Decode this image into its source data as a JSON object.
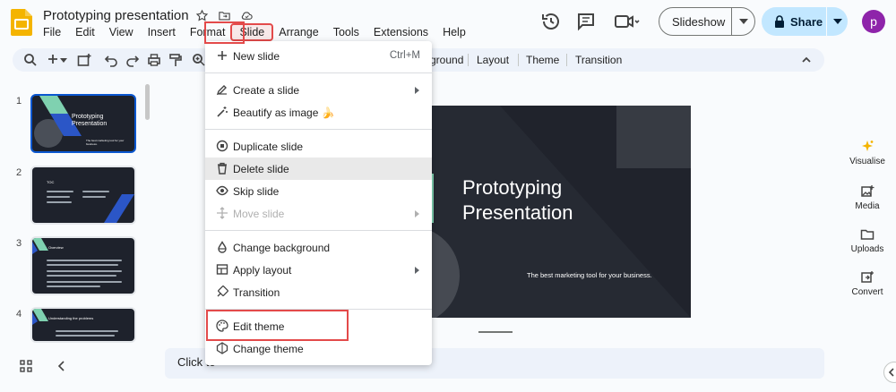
{
  "document": {
    "title": "Prototyping presentation"
  },
  "menubar": {
    "items": [
      "File",
      "Edit",
      "View",
      "Insert",
      "Format",
      "Slide",
      "Arrange",
      "Tools",
      "Extensions",
      "Help"
    ],
    "active": "Slide"
  },
  "header": {
    "slideshow_label": "Slideshow",
    "share_label": "Share",
    "avatar_letter": "p"
  },
  "toolbar": {
    "text_items": [
      "Background",
      "Layout",
      "Theme",
      "Transition"
    ],
    "background_visible": "ground"
  },
  "filmstrip": {
    "slides": [
      {
        "number": "1",
        "title": "Prototyping Presentation",
        "subtitle": "The best marketing tool for your business."
      },
      {
        "number": "2",
        "title": "TOC"
      },
      {
        "number": "3",
        "title": "Overview"
      },
      {
        "number": "4",
        "title": "Understanding the problems"
      }
    ]
  },
  "slide": {
    "title_line1": "Prototyping",
    "title_line2": "Presentation",
    "subtitle": "The best marketing tool for your business."
  },
  "notes": {
    "placeholder_visible": "Click to"
  },
  "sidebar": {
    "items": [
      "Visualise",
      "Media",
      "Uploads",
      "Convert"
    ]
  },
  "slide_menu": {
    "items": [
      {
        "label": "New slide",
        "shortcut": "Ctrl+M",
        "icon": "plus-icon"
      },
      {
        "label": "Create a slide",
        "submenu": true,
        "icon": "pencil-icon"
      },
      {
        "label": "Beautify as image",
        "emoji": "🍌",
        "icon": "magic-wand-icon"
      },
      {
        "label": "Duplicate slide",
        "icon": "duplicate-icon"
      },
      {
        "label": "Delete slide",
        "icon": "trash-icon",
        "hovered": true
      },
      {
        "label": "Skip slide",
        "icon": "eye-icon"
      },
      {
        "label": "Move slide",
        "submenu": true,
        "disabled": true,
        "icon": "move-icon"
      },
      {
        "label": "Change background",
        "icon": "paint-drop-icon"
      },
      {
        "label": "Apply layout",
        "submenu": true,
        "icon": "layout-icon"
      },
      {
        "label": "Transition",
        "icon": "transition-icon"
      },
      {
        "label": "Edit theme",
        "icon": "palette-icon",
        "highlighted": true
      },
      {
        "label": "Change theme",
        "icon": "theme-icon"
      }
    ]
  },
  "colors": {
    "accent_blue": "#0b57d0",
    "share_bg": "#c2e7ff",
    "highlight_red": "#e34a4a",
    "slide_bg": "#20232c",
    "avatar": "#8e24aa"
  }
}
